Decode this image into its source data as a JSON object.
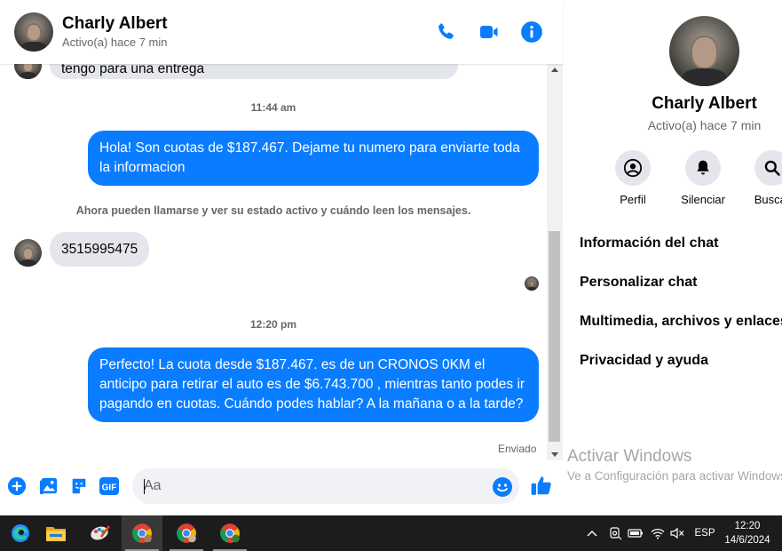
{
  "contact": {
    "name": "Charly Albert",
    "status": "Activo(a) hace 7 min"
  },
  "header": {
    "icons": [
      "phone-icon",
      "video-camera-icon",
      "info-icon"
    ]
  },
  "messages": {
    "partial_text": "tengo para una entrega",
    "time_1": "11:44 am",
    "outgoing_1": "Hola! Son cuotas de $187.467. Dejame tu numero para enviarte toda la informacion",
    "system_note": "Ahora pueden llamarse y ver su estado activo y cuándo leen los mensajes.",
    "incoming_1": "3515995475",
    "time_2": "12:20 pm",
    "outgoing_2": "Perfecto! La cuota desde $187.467. es de un CRONOS 0KM el anticipo para retirar el auto es de $6.743.700 , mientras tanto podes ir pagando en cuotas. Cuándo podes hablar? A la mañana o a la tarde?",
    "delivery_status": "Enviado"
  },
  "composer": {
    "placeholder": "Aa",
    "gif_label": "GIF",
    "icons": [
      "plus-icon",
      "photo-icon",
      "sticker-icon",
      "gif-icon",
      "emoji-icon",
      "thumbs-up-icon"
    ]
  },
  "info_panel": {
    "actions": [
      {
        "label": "Perfil",
        "icon": "profile-icon"
      },
      {
        "label": "Silenciar",
        "icon": "bell-icon"
      },
      {
        "label": "Buscar",
        "icon": "search-icon"
      }
    ],
    "menu": [
      "Información del chat",
      "Personalizar chat",
      "Multimedia, archivos y enlaces",
      "Privacidad y ayuda"
    ]
  },
  "watermark": {
    "title": "Activar Windows",
    "subtitle": "Ve a Configuración para activar Windows."
  },
  "taskbar": {
    "apps": [
      "edge-icon",
      "file-explorer-icon",
      "paint-icon",
      "chrome-icon",
      "chrome-icon",
      "chrome-icon"
    ],
    "language": "ESP",
    "time": "12:20",
    "date": "14/6/2024"
  },
  "colors": {
    "messenger_blue": "#0a7cff",
    "incoming_bubble": "#e4e6eb",
    "taskbar": "#1c1c1c"
  }
}
